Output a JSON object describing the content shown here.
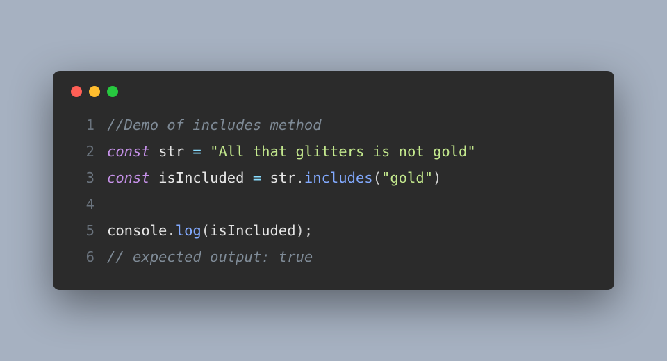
{
  "window": {
    "buttons": [
      "close",
      "minimize",
      "zoom"
    ]
  },
  "code": {
    "line_numbers": [
      "1",
      "2",
      "3",
      "4",
      "5",
      "6"
    ],
    "l1": {
      "comment": "//Demo of includes method"
    },
    "l2": {
      "kw": "const",
      "var": "str",
      "eq": " = ",
      "str": "\"All that glitters is not gold\""
    },
    "l3": {
      "kw": "const",
      "var": "isIncluded",
      "eq": " = ",
      "obj": "str",
      "dot": ".",
      "method": "includes",
      "open": "(",
      "arg": "\"gold\"",
      "close": ")"
    },
    "l5": {
      "obj": "console",
      "dot": ".",
      "method": "log",
      "open": "(",
      "arg": "isIncluded",
      "close": ")",
      "semi": ";"
    },
    "l6": {
      "comment": "// expected output: true"
    }
  }
}
